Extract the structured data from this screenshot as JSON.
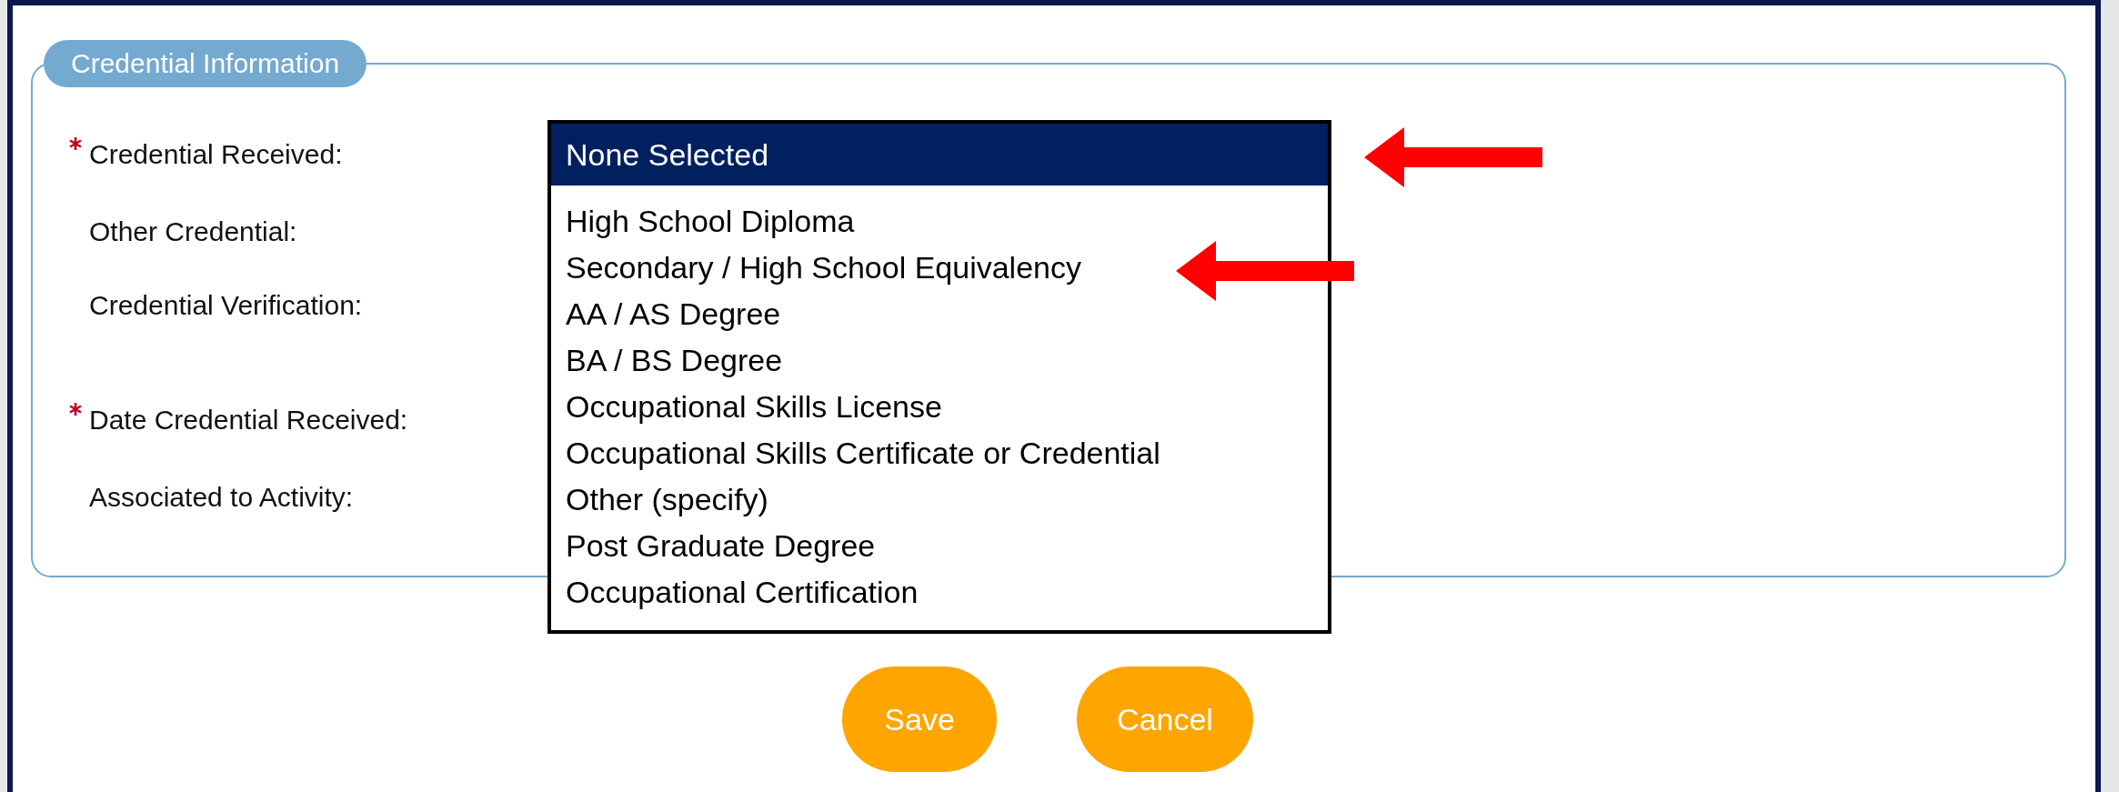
{
  "panel": {
    "title": "Credential Information"
  },
  "fields": [
    {
      "label": "Credential Received:",
      "required": true
    },
    {
      "label": "Other Credential:",
      "required": false
    },
    {
      "label": "Credential Verification:",
      "required": false
    },
    {
      "label": "Date Credential Received:",
      "required": true
    },
    {
      "label": "Associated to Activity:",
      "required": false
    }
  ],
  "dropdown": {
    "options": [
      {
        "label": "None Selected",
        "selected": true
      },
      {
        "label": "High School Diploma",
        "selected": false
      },
      {
        "label": "Secondary / High School Equivalency",
        "selected": false
      },
      {
        "label": "AA / AS Degree",
        "selected": false
      },
      {
        "label": "BA / BS Degree",
        "selected": false
      },
      {
        "label": "Occupational Skills License",
        "selected": false
      },
      {
        "label": "Occupational Skills Certificate or Credential",
        "selected": false
      },
      {
        "label": "Other (specify)",
        "selected": false
      },
      {
        "label": "Post Graduate Degree",
        "selected": false
      },
      {
        "label": "Occupational Certification",
        "selected": false
      }
    ]
  },
  "buttons": [
    "Save",
    "Cancel"
  ]
}
